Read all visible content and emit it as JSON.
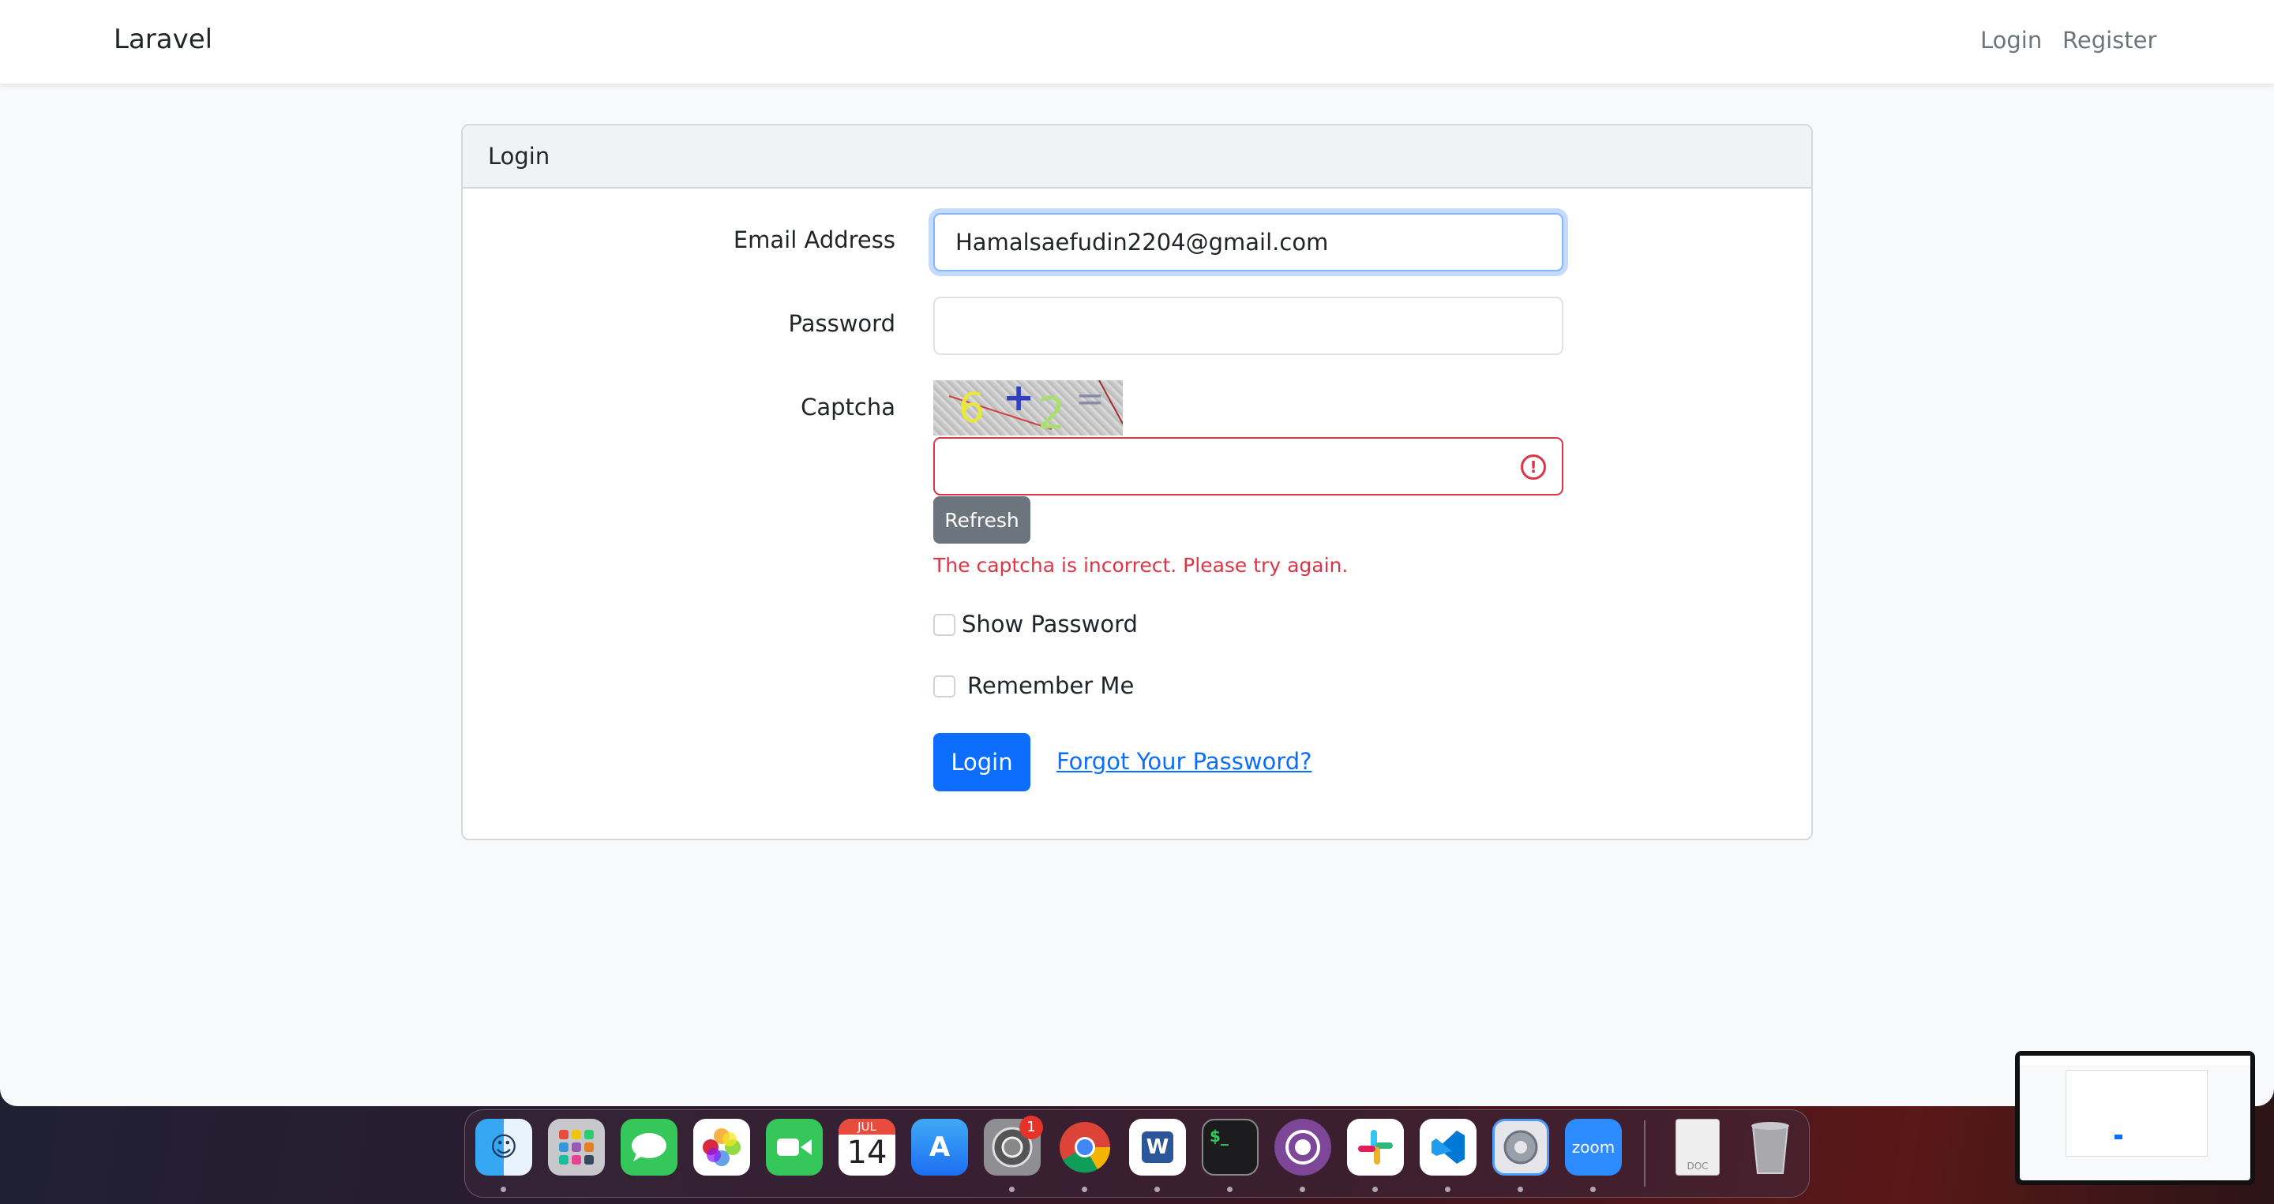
{
  "navbar": {
    "brand": "Laravel",
    "login_link": "Login",
    "register_link": "Register"
  },
  "card": {
    "header": "Login",
    "email_label": "Email Address",
    "email_value": "Hamalsaefudin2204@gmail.com",
    "password_label": "Password",
    "password_value": "",
    "captcha_label": "Captcha",
    "captcha_image_text": [
      "6",
      "+",
      "2",
      "="
    ],
    "captcha_value": "",
    "refresh_button": "Refresh",
    "captcha_error": "The captcha is incorrect. Please try again.",
    "show_password_label": "Show Password",
    "remember_me_label": "Remember Me",
    "login_button": "Login",
    "forgot_password_link": "Forgot Your Password?"
  },
  "dock": {
    "apps": [
      "Finder",
      "Launchpad",
      "Messages",
      "Photos",
      "FaceTime",
      "Calendar",
      "App Store",
      "System Preferences",
      "Chrome",
      "Word",
      "Terminal",
      "Tor Browser",
      "Slack",
      "Visual Studio Code",
      "Settings",
      "Zoom",
      "Document",
      "Trash"
    ],
    "calendar_month": "JUL",
    "calendar_day": "14",
    "settings_badge": "1",
    "zoom_label": "zoom",
    "doc_label": "DOC"
  },
  "colors": {
    "primary": "#0d6efd",
    "danger": "#dc3545",
    "secondary": "#6c757d",
    "page_bg": "#f8f9fa"
  }
}
